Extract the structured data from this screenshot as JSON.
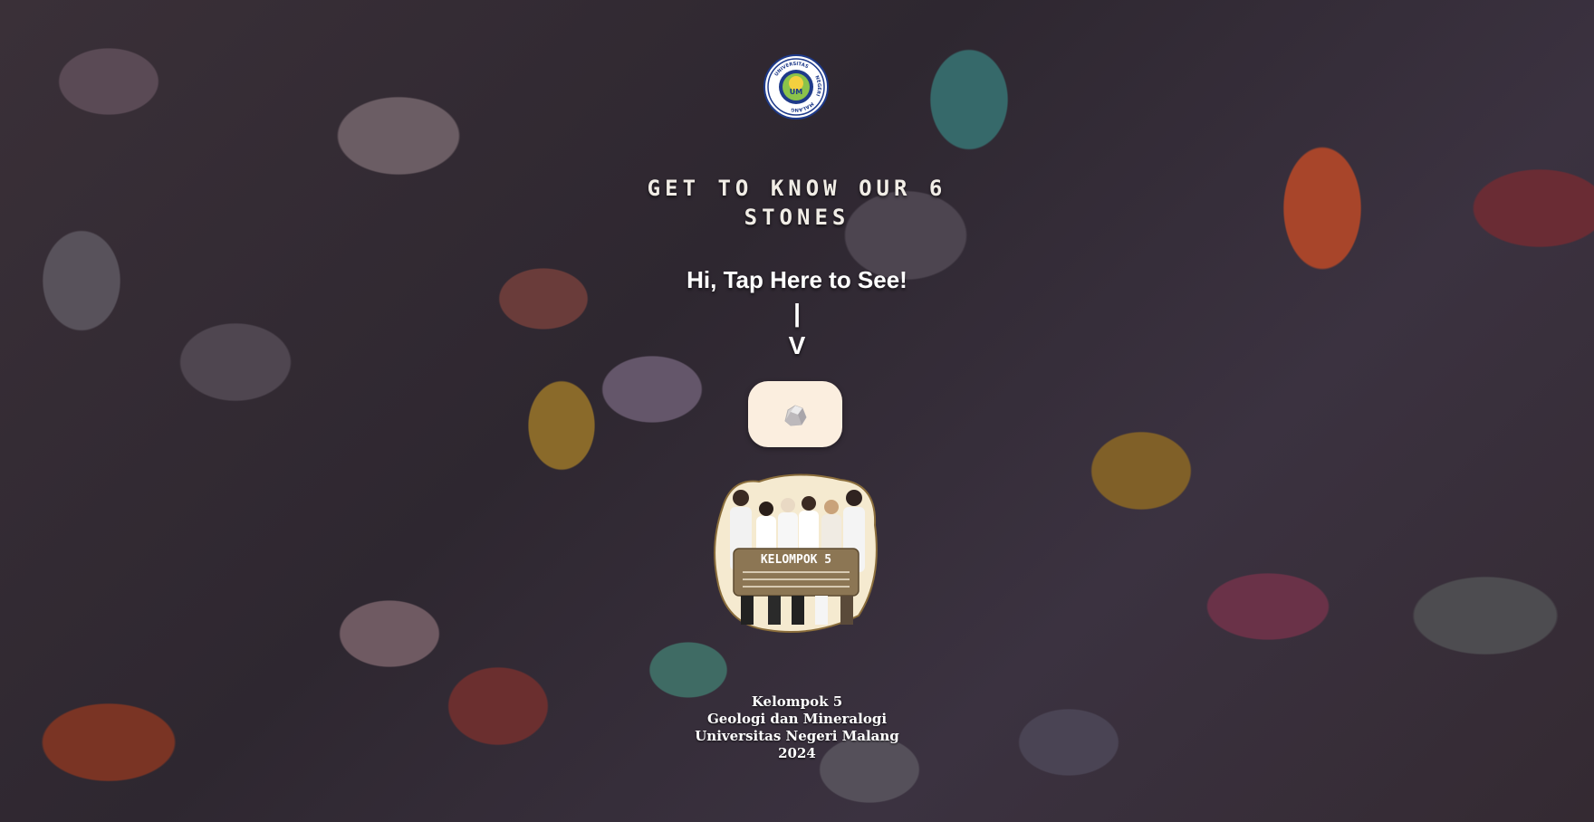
{
  "logo": {
    "ring_text_top": "NEGERI",
    "ring_text_left": "UNIVERSITAS",
    "ring_text_right": "MALANG",
    "emblem_text": "UM"
  },
  "headline": {
    "line1": "GET TO KNOW OUR 6",
    "line2": "STONES"
  },
  "prompt": {
    "text": "Hi, Tap Here to See!",
    "arrow_shaft": "|",
    "arrow_head": "V"
  },
  "stone_button": {
    "icon": "stone-icon",
    "color": "#fbeedf"
  },
  "group_photo": {
    "banner": "KELOMPOK 5"
  },
  "caption": {
    "line1": "Kelompok 5",
    "line2": "Geologi dan Mineralogi",
    "line3": "Universitas Negeri Malang",
    "line4": "2024"
  }
}
